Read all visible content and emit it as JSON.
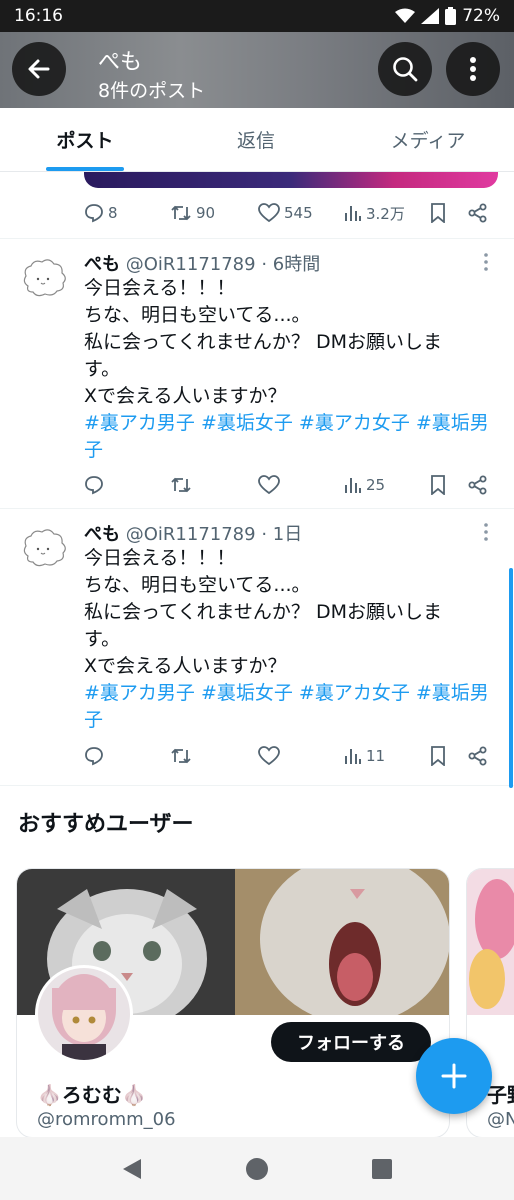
{
  "status_bar": {
    "time": "16:16",
    "battery": "72%"
  },
  "header": {
    "title": "ぺも",
    "subtitle": "8件のポスト",
    "back_icon": "arrow-left-icon",
    "search_icon": "search-icon",
    "more_icon": "more-vertical-icon"
  },
  "tabs": [
    {
      "label": "ポスト",
      "active": true
    },
    {
      "label": "返信",
      "active": false
    },
    {
      "label": "メディア",
      "active": false
    }
  ],
  "prev_post": {
    "replies": "8",
    "reposts": "90",
    "likes": "545",
    "views": "3.2万"
  },
  "posts": [
    {
      "name": "ぺも",
      "handle": "@OiR1171789",
      "time": "· 6時間",
      "lines": [
        "今日会える！！！",
        "ちな、明日も空いてる...。",
        "私に会ってくれませんか？ DMお願いしま",
        "す。",
        "Xで会える人いますか？"
      ],
      "tag_lines": [
        "#裏アカ男子 #裏垢女子 #裏アカ女子 #裏垢男",
        "子"
      ],
      "replies": "",
      "reposts": "",
      "likes": "",
      "views": "25"
    },
    {
      "name": "ぺも",
      "handle": "@OiR1171789",
      "time": "· 1日",
      "lines": [
        "今日会える！！！",
        "ちな、明日も空いてる...。",
        "私に会ってくれませんか？ DMお願いしま",
        "す。",
        "Xで会える人いますか？"
      ],
      "tag_lines": [
        "#裏アカ男子 #裏垢女子 #裏アカ女子 #裏垢男",
        "子"
      ],
      "replies": "",
      "reposts": "",
      "likes": "",
      "views": "11"
    }
  ],
  "recommendations": {
    "title": "おすすめユーザー",
    "cards": [
      {
        "name": "🧄ろむむ🧄",
        "handle": "@romromm_06",
        "follow_label": "フォローする"
      },
      {
        "name": "子野",
        "handle": "@N"
      }
    ]
  },
  "colors": {
    "accent": "#1d9bf0",
    "text": "#0f1419",
    "muted": "#536471"
  }
}
